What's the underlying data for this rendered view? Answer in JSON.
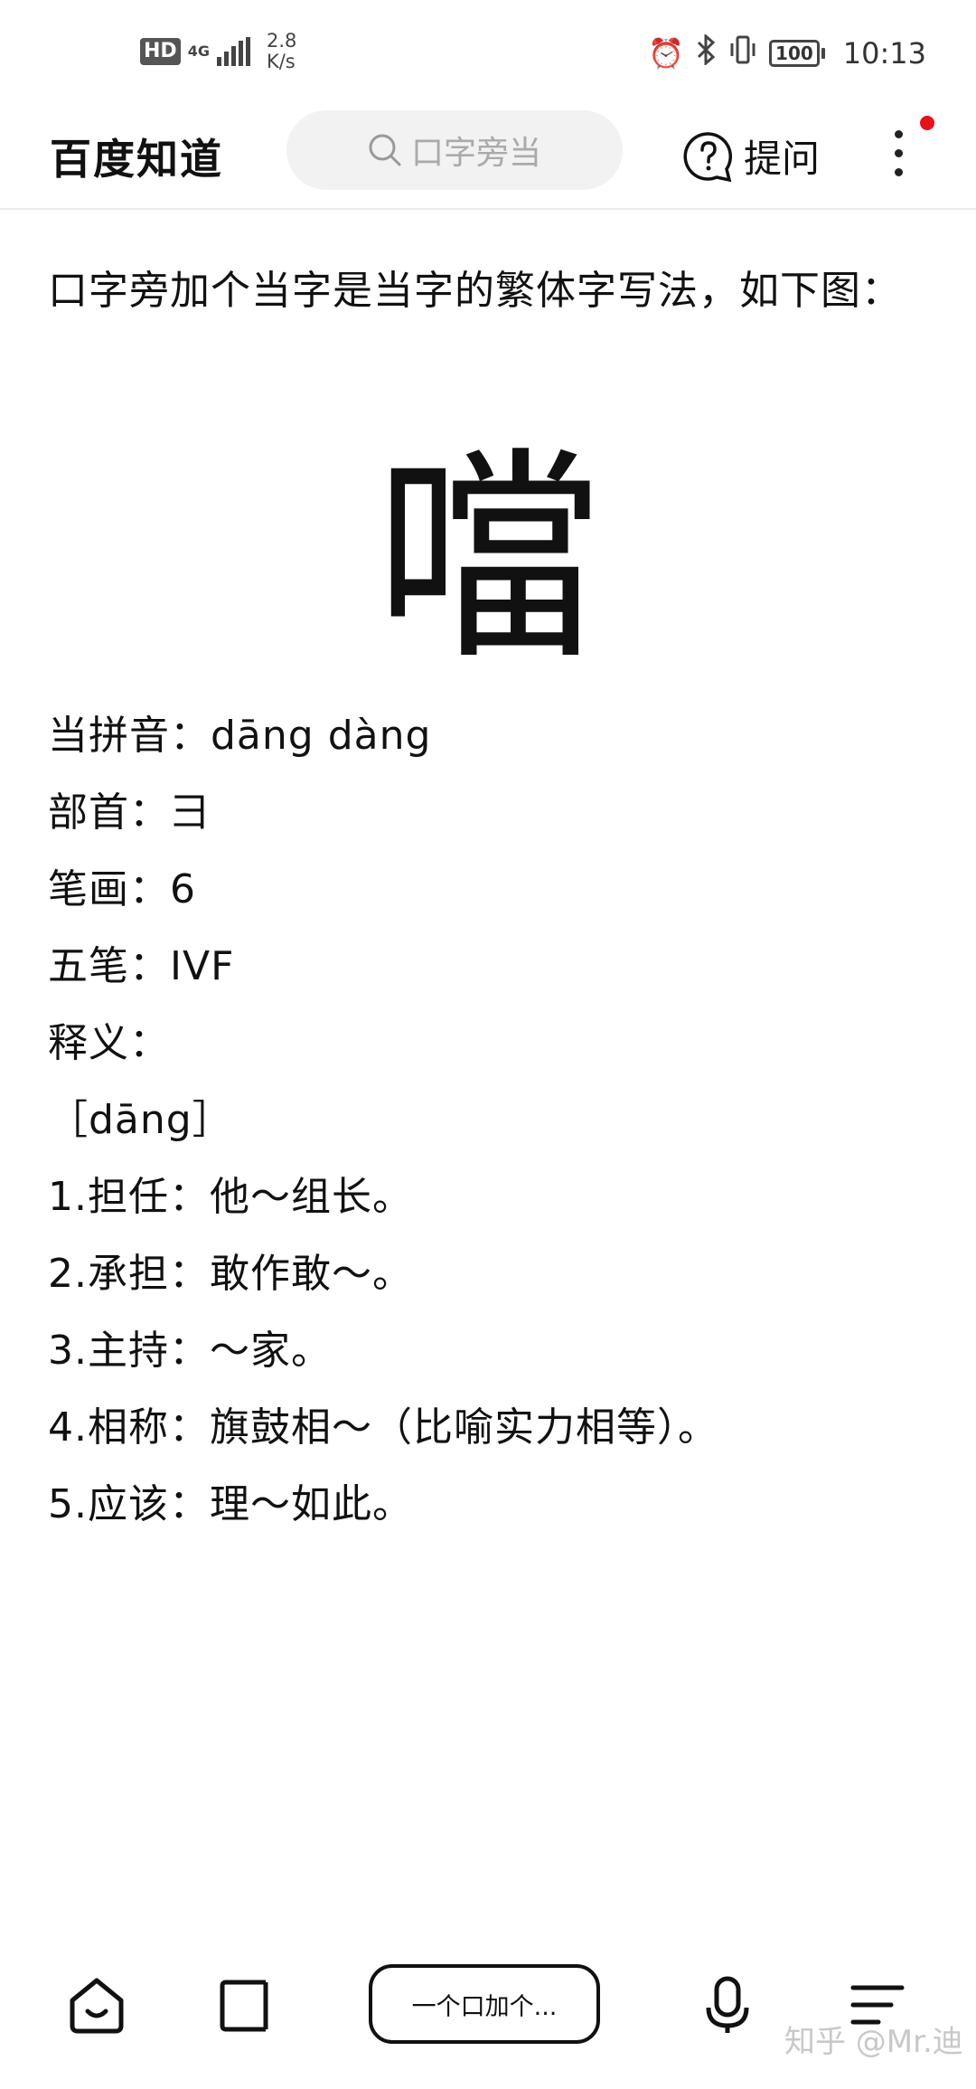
{
  "status_bar": {
    "hd": "HD",
    "network": "4G",
    "speed_value": "2.8",
    "speed_unit": "K/s",
    "battery": "100",
    "time": "10:13"
  },
  "header": {
    "brand": "百度知道",
    "search_text": "口字旁当",
    "ask_label": "提问"
  },
  "answer": {
    "intro": "口字旁加个当字是当字的繁体字写法，如下图：",
    "glyph": "噹",
    "lines": [
      "当拼音：dāng  dàng",
      "部首：彐",
      "笔画：6",
      "五笔：IVF",
      "释义：",
      "［dāng］",
      "1.担任：他～组长。",
      "2.承担：敢作敢～。",
      "3.主持：～家。",
      "4.相称：旗鼓相～（比喻实力相等）。",
      "5.应该：理～如此。"
    ]
  },
  "bottom_bar": {
    "query": "一个口加个...",
    "watermark": "知乎 @Mr.迪"
  },
  "colors": {
    "accent_dot": "#e8101a",
    "search_bg": "#f2f2f2",
    "text": "#111111"
  },
  "icons": [
    "search-icon",
    "question-bubble-icon",
    "more-vertical-icon",
    "home-icon",
    "tabs-icon",
    "microphone-icon",
    "menu-icon",
    "alarm-icon",
    "bluetooth-icon",
    "vibrate-icon",
    "battery-icon",
    "signal-icon"
  ]
}
